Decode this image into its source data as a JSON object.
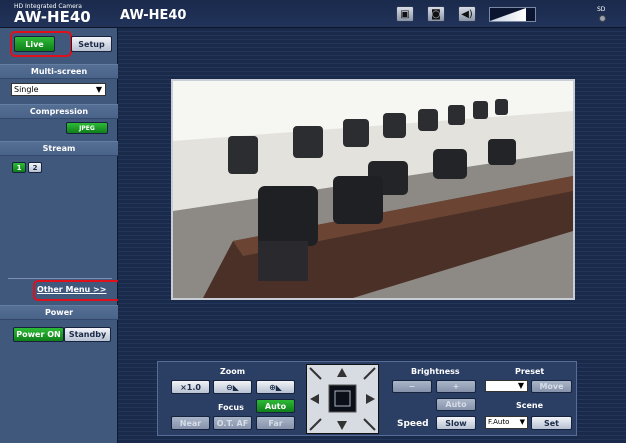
{
  "header": {
    "brand_small": "HD Integrated Camera",
    "brand_model": "AW-HE40",
    "title": "AW-HE40",
    "icons": [
      "snapshot-icon",
      "camera-icon",
      "volume-icon"
    ],
    "signal_level": 0.8,
    "sd_label": "SD"
  },
  "sidebar": {
    "live_label": "Live",
    "setup_label": "Setup",
    "multiscreen_title": "Multi-screen",
    "multiscreen_value": "Single",
    "compression_title": "Compression",
    "compression_button": "JPEG",
    "stream_title": "Stream",
    "stream_buttons": [
      "1",
      "2"
    ],
    "other_menu": "Other Menu >>",
    "power_title": "Power",
    "power_on": "Power ON",
    "standby": "Standby"
  },
  "controls": {
    "zoom_title": "Zoom",
    "zoom_x1": "×1.0",
    "focus_title": "Focus",
    "focus_auto": "Auto",
    "focus_near": "Near",
    "focus_otaf": "O.T. AF",
    "focus_far": "Far",
    "brightness_title": "Brightness",
    "brightness_minus": "−",
    "brightness_plus": "+",
    "brightness_auto": "Auto",
    "speed_label": "Speed",
    "speed_value": "Slow",
    "preset_title": "Preset",
    "preset_move": "Move",
    "scene_title": "Scene",
    "scene_value": "F.Auto",
    "scene_set": "Set"
  },
  "colors": {
    "accent_green": "#1a9e26",
    "highlight_red": "#e0101a",
    "sidebar_bg": "#41587d"
  }
}
